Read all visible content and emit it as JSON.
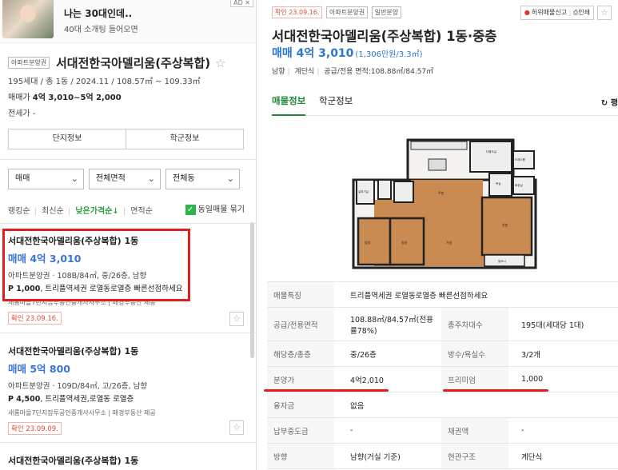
{
  "ad": {
    "title": "나는 30대인데..",
    "subtitle": "40대 소개팅 들어오면",
    "badge": "AD ✕"
  },
  "complex": {
    "tag": "아파트분양권",
    "name": "서대전한국아델리움(주상복합)",
    "meta": "195세대 / 총 1동 / 2024.11 / 108.57㎡ ~ 109.33㎡",
    "price_label": "매매가",
    "price_value": "4억 3,010~5억 2,000",
    "rent": "전세가 -",
    "tabs": [
      "단지정보",
      "학군정보"
    ]
  },
  "filters": {
    "trade": "매매",
    "area": "전체면적",
    "dong": "전체동"
  },
  "sort": {
    "items": [
      "랭킹순",
      "최신순",
      "낮은가격순↓",
      "면적순"
    ],
    "active_index": 2,
    "group_label": "동일매물 묶기",
    "group_checked": true
  },
  "listings": [
    {
      "title": "서대전한국아델리움(주상복합) 1동",
      "price": "매매 4억 3,010",
      "spec": "아파트분양권 · 108B/84㎡, 중/26층, 남향",
      "desc_bold": "P 1,000",
      "desc": ", 트리플역세권 로열동로열층 빠른선점하세요",
      "agent": "새롬마을7단지잡투공인중개사사무소 | 매경부동산 제공",
      "confirm": "확인 23.09.16."
    },
    {
      "title": "서대전한국아델리움(주상복합) 1동",
      "price": "매매 5억 800",
      "spec": "아파트분양권 · 109D/84㎡, 고/26층, 남향",
      "desc_bold": "P 4,500",
      "desc": ", 트리플역세권,로열동 로열층",
      "agent": "새롬마을7단지잡투공인중개사사무소 | 매경부동산 제공",
      "confirm": "확인 23.09.09."
    },
    {
      "title": "서대전한국아델리움(주상복합) 1동"
    }
  ],
  "detail": {
    "confirm": "확인 23.09.16.",
    "tags": [
      "아파트분양권",
      "일반분양"
    ],
    "report_label": "허위매물신고",
    "print_label": "인쇄",
    "title": "서대전한국아델리움(주상복합) 1동·중층",
    "price": "매매 4억 3,010",
    "price_unit": "(1,306만원/3.3㎡)",
    "sub": [
      "남향",
      "계단식",
      "공급/전용 면적:108.88㎡/84.57㎡"
    ],
    "tabs": [
      "매물정보",
      "학군정보"
    ],
    "refresh_label": "평",
    "plan_labels": [
      "실외기실",
      "다용도실",
      "드레스룸",
      "화장실",
      "침실",
      "욕실",
      "주방",
      "거실",
      "안방",
      "발코니"
    ],
    "rows": [
      {
        "k1": "매물특징",
        "full": "트리플역세권 로열동로열층 빠른선점하세요"
      },
      {
        "k1": "공급/전용면적",
        "v1": "108.88㎡/84.57㎡(전용률78%)",
        "k2": "총주차대수",
        "v2": "195대(세대당 1대)"
      },
      {
        "k1": "해당층/총층",
        "v1": "중/26층",
        "k2": "방수/욕실수",
        "v2": "3/2개"
      },
      {
        "k1": "분양가",
        "v1": "4억2,010",
        "k2": "프리미엄",
        "v2": "1,000"
      },
      {
        "k1": "융자금",
        "full": "없음"
      },
      {
        "k1": "납부중도금",
        "v1": "-",
        "k2": "채권액",
        "v2": "-"
      },
      {
        "k1": "방향",
        "v1": "남향(거실 기준)",
        "k2": "현관구조",
        "v2": "계단식"
      }
    ]
  },
  "colors": {
    "accent_green": "#1f8a3a",
    "price_blue": "#3a74d8",
    "highlight_red": "#e02020"
  }
}
